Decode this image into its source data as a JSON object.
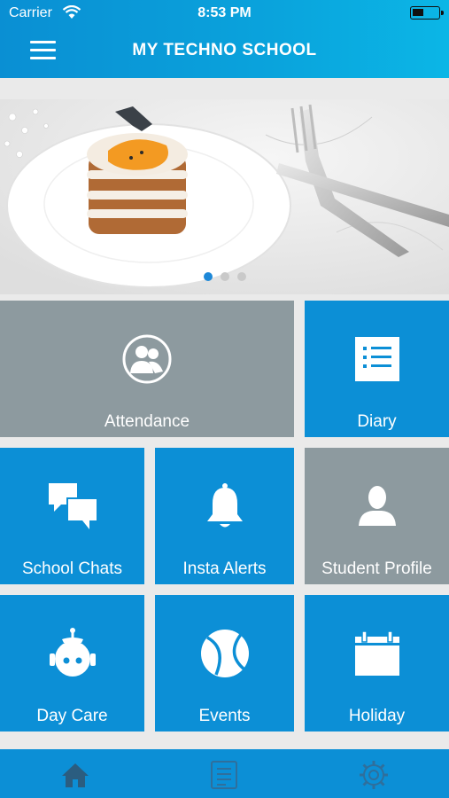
{
  "status_bar": {
    "carrier": "Carrier",
    "time": "8:53 PM"
  },
  "header": {
    "title": "MY TECHNO SCHOOL",
    "menu_icon": "hamburger-menu-icon"
  },
  "banner": {
    "image": "cake-on-plate-with-cutlery",
    "slide_count": 3,
    "active_slide": 1
  },
  "tiles": [
    {
      "label": "Attendance",
      "icon": "users-icon",
      "color": "#8d9a9f"
    },
    {
      "label": "Diary",
      "icon": "list-icon",
      "color": "#0c8fd6"
    },
    {
      "label": "School Chats",
      "icon": "chat-bubbles-icon",
      "color": "#0c8fd6"
    },
    {
      "label": "Insta Alerts",
      "icon": "bell-icon",
      "color": "#0c8fd6"
    },
    {
      "label": "Student Profile",
      "icon": "person-icon",
      "color": "#8d9a9f"
    },
    {
      "label": "Day Care",
      "icon": "robot-face-icon",
      "color": "#0c8fd6"
    },
    {
      "label": "Events",
      "icon": "tennis-ball-icon",
      "color": "#0c8fd6"
    },
    {
      "label": "Holiday",
      "icon": "calendar-icon",
      "color": "#0c8fd6"
    }
  ],
  "tab_bar": {
    "tabs": [
      {
        "icon": "home-icon",
        "active": true
      },
      {
        "icon": "document-icon",
        "active": false
      },
      {
        "icon": "settings-gear-icon",
        "active": false
      }
    ]
  },
  "colors": {
    "primary_blue": "#0c8fd6",
    "tile_gray": "#8d9a9f",
    "active_dot": "#1d88d8"
  }
}
